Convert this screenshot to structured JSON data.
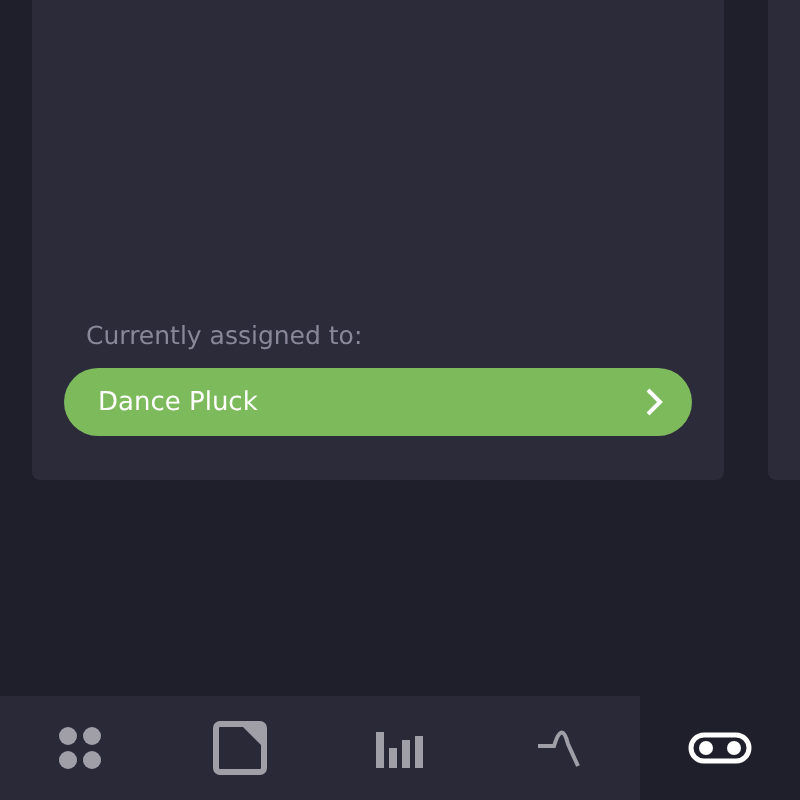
{
  "card": {
    "assigned_label": "Currently assigned to:",
    "assigned_preset": "Dance Pluck"
  },
  "tabs": [
    {
      "kind": "pads",
      "selected": false
    },
    {
      "kind": "square",
      "selected": false
    },
    {
      "kind": "bars",
      "selected": false
    },
    {
      "kind": "envelope",
      "selected": false
    },
    {
      "kind": "toggle",
      "selected": true
    }
  ]
}
